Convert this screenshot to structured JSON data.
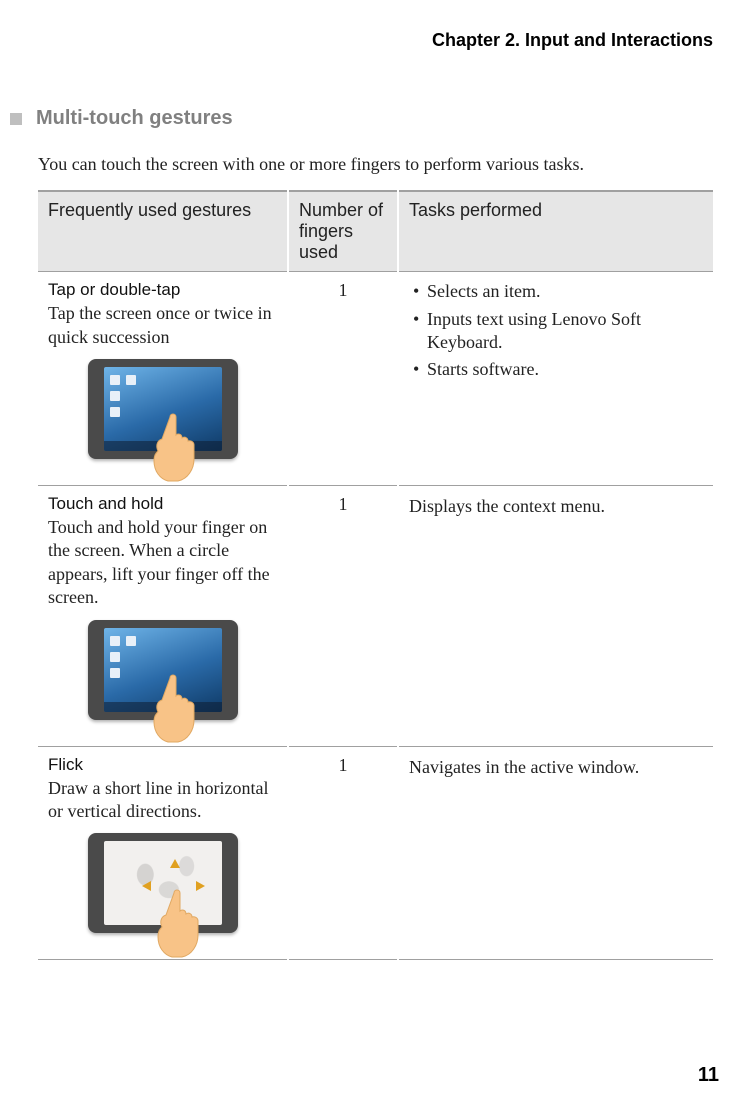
{
  "chapter_header": "Chapter 2. Input and Interactions",
  "section_title": "Multi-touch gestures",
  "intro": "You can touch the screen with one or more fingers to perform various tasks.",
  "table": {
    "headers": {
      "gesture": "Frequently used gestures",
      "fingers": "Number of fingers used",
      "tasks": "Tasks performed"
    },
    "rows": [
      {
        "name": "Tap or double-tap",
        "description": "Tap the screen once or twice in quick succession",
        "fingers": "1",
        "tasks": [
          "Selects an item.",
          "Inputs text using Lenovo Soft Keyboard.",
          "Starts software."
        ],
        "illustration": "tablet-tap"
      },
      {
        "name": "Touch and hold",
        "description": "Touch and hold your finger on the screen. When a circle appears, lift your finger off the screen.",
        "fingers": "1",
        "tasks_text": "Displays the context menu.",
        "illustration": "tablet-hold"
      },
      {
        "name": "Flick",
        "description": "Draw a short line in horizontal or vertical directions.",
        "fingers": "1",
        "tasks_text": "Navigates in the active window.",
        "illustration": "tablet-flick"
      }
    ]
  },
  "page_number": "11"
}
